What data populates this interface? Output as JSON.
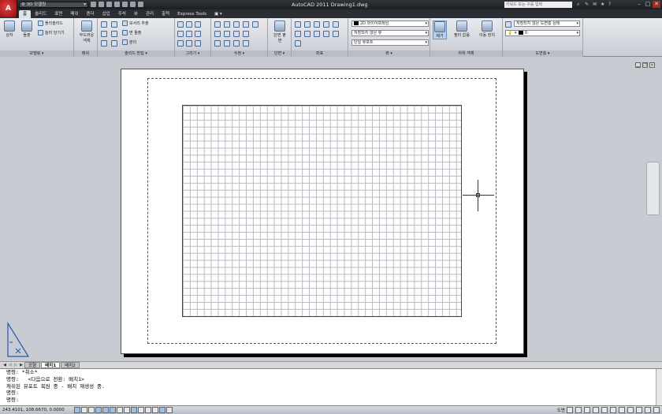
{
  "app": {
    "logo": "A",
    "title": "AutoCAD 2011    Drawing1.dwg"
  },
  "workspace": {
    "label": "3D 모델링"
  },
  "search": {
    "placeholder": "키워드 또는 구를 입력"
  },
  "ribbon_tabs": [
    {
      "label": "홈",
      "active": true
    },
    {
      "label": "솔리드"
    },
    {
      "label": "표면"
    },
    {
      "label": "메쉬"
    },
    {
      "label": "렌더"
    },
    {
      "label": "삽입"
    },
    {
      "label": "주석"
    },
    {
      "label": "뷰"
    },
    {
      "label": "관리"
    },
    {
      "label": "출력"
    },
    {
      "label": "Express Tools"
    },
    {
      "label": "▣ ▾"
    }
  ],
  "panels": {
    "modeling": {
      "title": "모델링 ▾",
      "box": "상자",
      "extrude": "돌출",
      "polysolid": "폴리솔리드",
      "presspull": "눌러 당기기"
    },
    "mesh": {
      "title": "메쉬",
      "smooth": "부드러운 객체"
    },
    "solid_edit": {
      "title": "솔리드 편집 ▾",
      "extract_edges": "모서리 추출",
      "offset_face": "면 돌출",
      "separate": "분리"
    },
    "draw": {
      "title": "그리기 ▾"
    },
    "modify": {
      "title": "수정 ▾"
    },
    "section": {
      "title": "단면 ▾",
      "plane": "단면 평면"
    },
    "coords": {
      "title": "좌표"
    },
    "view": {
      "title": "뷰 ▾",
      "visual_style": "2D 와이어프레임",
      "unsaved_view": "저장되지 않은 뷰",
      "single_viewport": "단일 뷰포트"
    },
    "subobject": {
      "title": "하위 객체",
      "none": "제거",
      "filter": "필터 없음",
      "move_gizmo": "이동 장치"
    },
    "layers": {
      "title": "도면층 ▾",
      "layer_state": "저장되지 않은 도면층 상태",
      "current_layer": "0"
    }
  },
  "layout_tabs": [
    {
      "label": "모형"
    },
    {
      "label": "배치1",
      "active": true
    },
    {
      "label": "배치2"
    }
  ],
  "command_lines": [
    "명령: *취소*",
    "명령:   <다음으로 전환: 배치1>",
    "캐쉬된 뷰포트 복원 중 - 배치 재생성 중.",
    "명령:",
    "명령:"
  ],
  "status": {
    "coords": "243.4101, 108.6670, 0.0000",
    "paper_label": "도면"
  },
  "colors": {
    "ribbon_bg": "#dfe3e8",
    "titlebar": "#1c1e22",
    "close": "#9a2b20",
    "workspace_bg": "#c8ccd2"
  }
}
